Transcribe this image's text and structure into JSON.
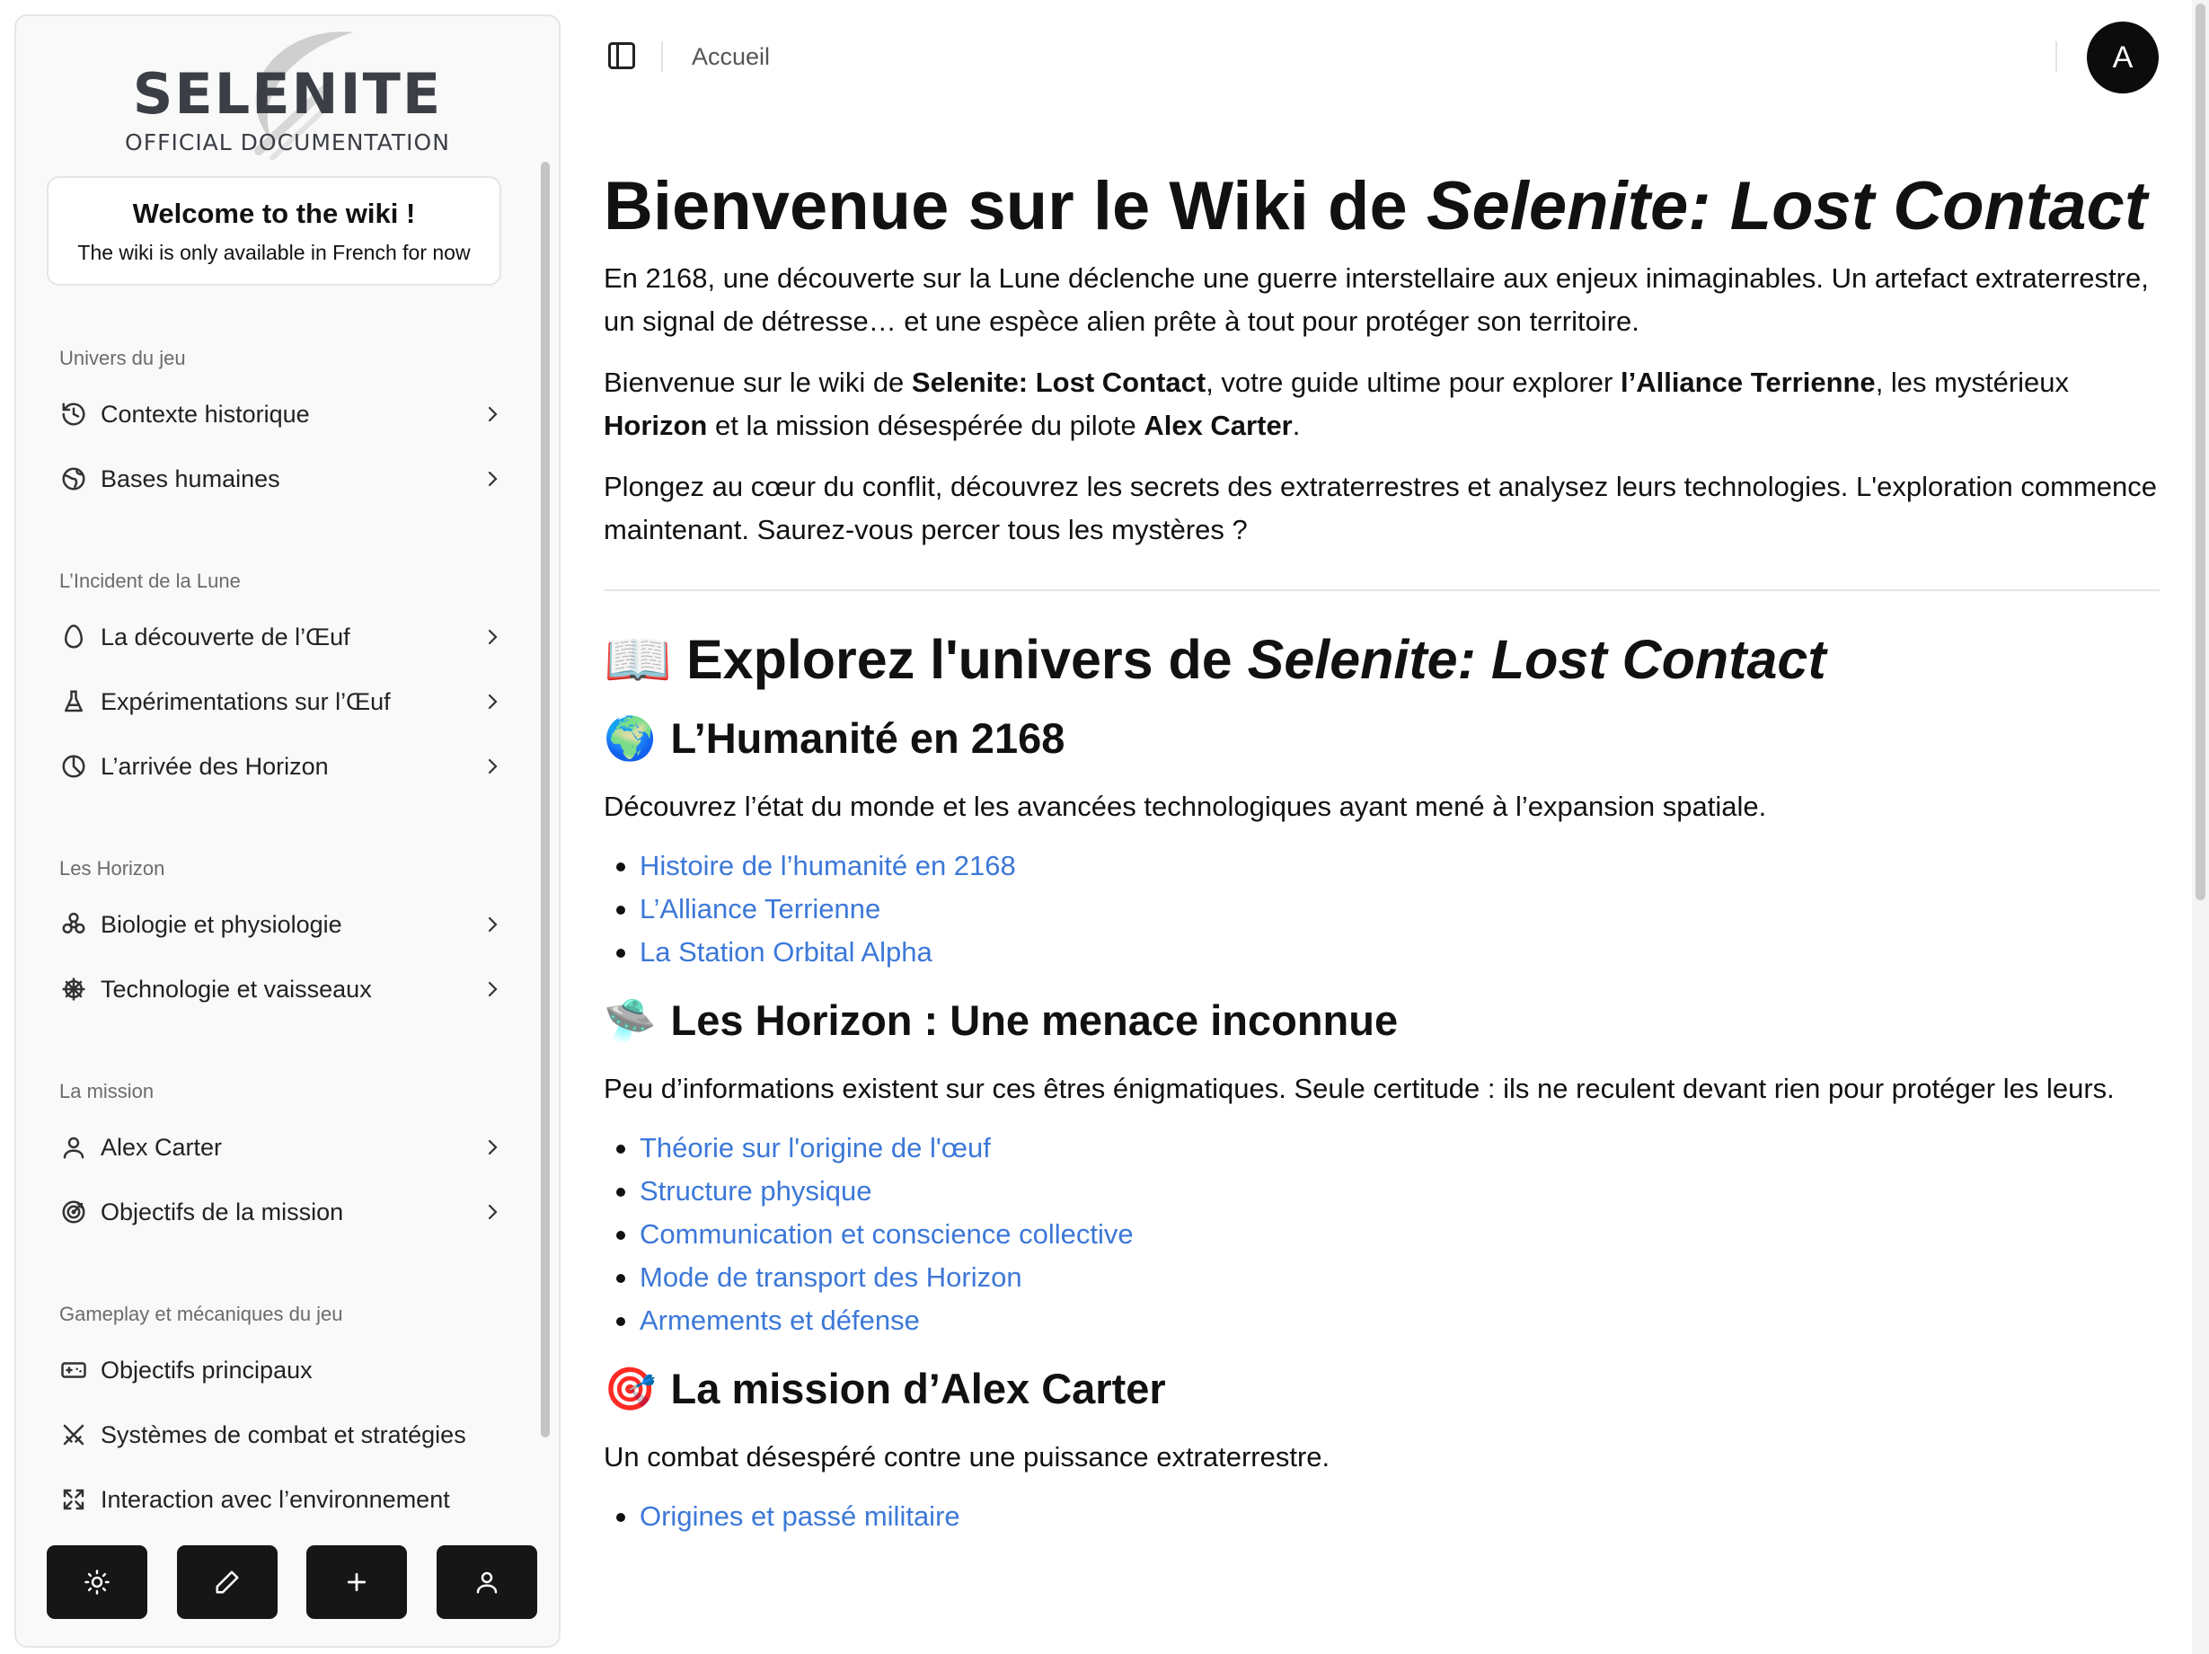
{
  "logo": {
    "title": "SELENITE",
    "subtitle": "OFFICIAL DOCUMENTATION"
  },
  "welcome": {
    "title": "Welcome to the wiki !",
    "text": "The wiki is only available in French for now"
  },
  "sidebar": {
    "groups": [
      {
        "label": "Univers du jeu",
        "items": [
          {
            "label": "Contexte historique",
            "icon": "history-icon",
            "chevron": true
          },
          {
            "label": "Bases humaines",
            "icon": "globe-icon",
            "chevron": true
          }
        ]
      },
      {
        "label": "L’Incident de la Lune",
        "items": [
          {
            "label": "La découverte de l’Œuf",
            "icon": "egg-icon",
            "chevron": true
          },
          {
            "label": "Expérimentations sur l’Œuf",
            "icon": "flask-icon",
            "chevron": true
          },
          {
            "label": "L’arrivée des Horizon",
            "icon": "pie-chart-icon",
            "chevron": true
          }
        ]
      },
      {
        "label": "Les Horizon",
        "items": [
          {
            "label": "Biologie et physiologie",
            "icon": "biohazard-icon",
            "chevron": true
          },
          {
            "label": "Technologie et vaisseaux",
            "icon": "ship-wheel-icon",
            "chevron": true
          }
        ]
      },
      {
        "label": "La mission",
        "items": [
          {
            "label": "Alex Carter",
            "icon": "user-icon",
            "chevron": true
          },
          {
            "label": "Objectifs de la mission",
            "icon": "target-icon",
            "chevron": true
          }
        ]
      },
      {
        "label": "Gameplay et mécaniques du jeu",
        "items": [
          {
            "label": "Objectifs principaux",
            "icon": "gamepad-icon",
            "chevron": false
          },
          {
            "label": "Systèmes de combat et stratégies",
            "icon": "swords-icon",
            "chevron": false
          },
          {
            "label": "Interaction avec l’environnement",
            "icon": "expand-icon",
            "chevron": false
          }
        ]
      }
    ]
  },
  "toolbar": {
    "buttons": [
      "sun-icon",
      "pencil-icon",
      "plus-icon",
      "user-icon"
    ]
  },
  "header": {
    "breadcrumb": "Accueil",
    "avatar": "A"
  },
  "main": {
    "title_plain": "Bienvenue sur le Wiki de ",
    "title_italic": "Selenite: Lost Contact",
    "intro": "En 2168, une découverte sur la Lune déclenche une guerre interstellaire aux enjeux inimaginables. Un artefact extraterrestre, un signal de détresse… et une espèce alien prête à tout pour protéger son territoire.",
    "p2": {
      "a": "Bienvenue sur le wiki de ",
      "b": "Selenite: Lost Contact",
      "c": ", votre guide ultime pour explorer ",
      "d": "l’Alliance Terrienne",
      "e": ", les mystérieux ",
      "f": "Horizon",
      "g": " et la mission désespérée du pilote ",
      "h": "Alex Carter",
      "i": "."
    },
    "p3": "Plongez au cœur du conflit, découvrez les secrets des extraterrestres et analysez leurs technologies. L'exploration commence maintenant. Saurez-vous percer tous les mystères ?",
    "explore": {
      "emoji": "📖",
      "plain": "Explorez l'univers de ",
      "italic": "Selenite: Lost Contact"
    },
    "sections": [
      {
        "emoji": "🌍",
        "title": "L’Humanité en 2168",
        "text": "Découvrez l’état du monde et les avancées technologiques ayant mené à l’expansion spatiale.",
        "links": [
          "Histoire de l’humanité en 2168",
          "L’Alliance Terrienne",
          "La Station Orbital Alpha"
        ]
      },
      {
        "emoji": "🛸",
        "title": "Les Horizon : Une menace inconnue",
        "text": "Peu d’informations existent sur ces êtres énigmatiques. Seule certitude : ils ne reculent devant rien pour protéger les leurs.",
        "links": [
          "Théorie sur l'origine de l'œuf",
          "Structure physique",
          "Communication et conscience collective",
          "Mode de transport des Horizon",
          "Armements et défense"
        ]
      },
      {
        "emoji": "🎯",
        "title": "La mission d’Alex Carter",
        "text": "Un combat désespéré contre une puissance extraterrestre.",
        "links": [
          "Origines et passé militaire"
        ]
      }
    ]
  }
}
